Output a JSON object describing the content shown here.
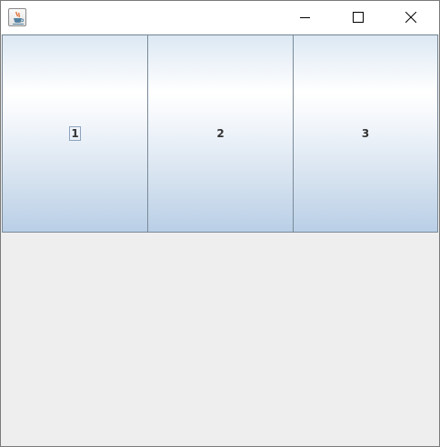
{
  "window": {
    "title": "",
    "icon": "java-coffee-cup-icon",
    "controls": [
      "minimize-icon",
      "maximize-icon",
      "close-icon"
    ]
  },
  "buttons": [
    {
      "label": "1",
      "focused": true
    },
    {
      "label": "2",
      "focused": false
    },
    {
      "label": "3",
      "focused": false
    }
  ],
  "colors": {
    "titlebar": "#ffffff",
    "content_background": "#eeeeee",
    "button_border": "#7a8a99",
    "button_gradient_top": "#ffffff",
    "button_gradient_bottom": "#b9cfe6",
    "label_text": "#333333"
  }
}
